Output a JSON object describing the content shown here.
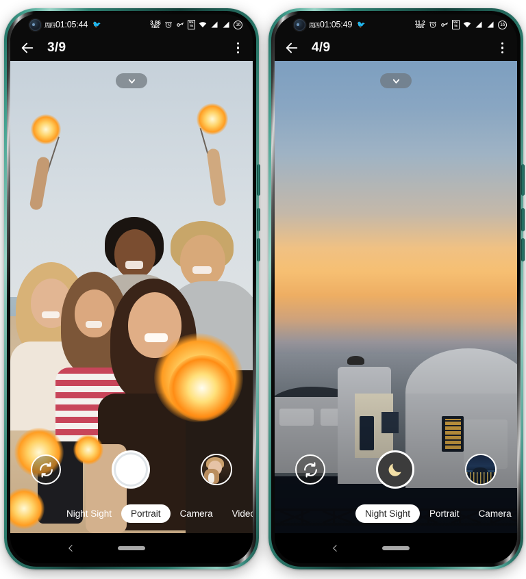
{
  "phones": [
    {
      "id": "phone-left",
      "status_bar": {
        "day": "周四",
        "time": "01:05:44",
        "emoji": "🐦",
        "net_speed_value": "3.86",
        "net_speed_unit": "KB/S",
        "alarm_icon": "alarm-icon",
        "key_icon": "vpn-key-icon",
        "volte_label": "VoLTE",
        "wifi_icon": "wifi-icon",
        "signal_icon_1": "signal-bars-icon",
        "signal_icon_2": "signal-bars-icon",
        "battery_level": "16"
      },
      "app_bar": {
        "back_icon": "back-arrow-icon",
        "title": "3/9",
        "overflow_icon": "overflow-menu-icon"
      },
      "viewfinder": {
        "expand_icon": "chevron-down-icon",
        "scene": "group-selfie-sparklers"
      },
      "controls": {
        "flip_icon": "flip-camera-icon",
        "shutter_label": "shutter-button",
        "shutter_style": "portrait",
        "thumbnail_label": "gallery-thumbnail"
      },
      "modes": [
        {
          "label": "Night Sight",
          "active": false
        },
        {
          "label": "Portrait",
          "active": true
        },
        {
          "label": "Camera",
          "active": false
        },
        {
          "label": "Video",
          "active": false
        }
      ],
      "nav_bar": {
        "back_icon": "nav-back-icon",
        "home_icon": "home-pill-indicator"
      }
    },
    {
      "id": "phone-right",
      "status_bar": {
        "day": "周四",
        "time": "01:05:49",
        "emoji": "🐦",
        "net_speed_value": "11.2",
        "net_speed_unit": "KB/S",
        "alarm_icon": "alarm-icon",
        "key_icon": "vpn-key-icon",
        "volte_label": "VoLTE",
        "wifi_icon": "wifi-icon",
        "signal_icon_1": "signal-bars-icon",
        "signal_icon_2": "signal-bars-icon",
        "battery_level": "16"
      },
      "app_bar": {
        "back_icon": "back-arrow-icon",
        "title": "4/9",
        "overflow_icon": "overflow-menu-icon"
      },
      "viewfinder": {
        "expand_icon": "chevron-down-icon",
        "scene": "santorini-sunset-night"
      },
      "controls": {
        "flip_icon": "flip-camera-icon",
        "shutter_label": "shutter-button",
        "shutter_style": "night",
        "thumbnail_label": "gallery-thumbnail"
      },
      "modes": [
        {
          "label": "Night Sight",
          "active": true
        },
        {
          "label": "Portrait",
          "active": false
        },
        {
          "label": "Camera",
          "active": false
        }
      ],
      "nav_bar": {
        "back_icon": "nav-back-icon",
        "home_icon": "home-pill-indicator"
      }
    }
  ],
  "colors": {
    "frame_teal": "#2f8273",
    "status_bar_bg": "#0b0b0b",
    "mode_active_bg": "#ffffff",
    "mode_text": "#ffffff",
    "shutter_night_bg": "#3c3c3c",
    "moon_yellow": "#f2dfa6",
    "nav_pill": "#a8a8a8"
  }
}
